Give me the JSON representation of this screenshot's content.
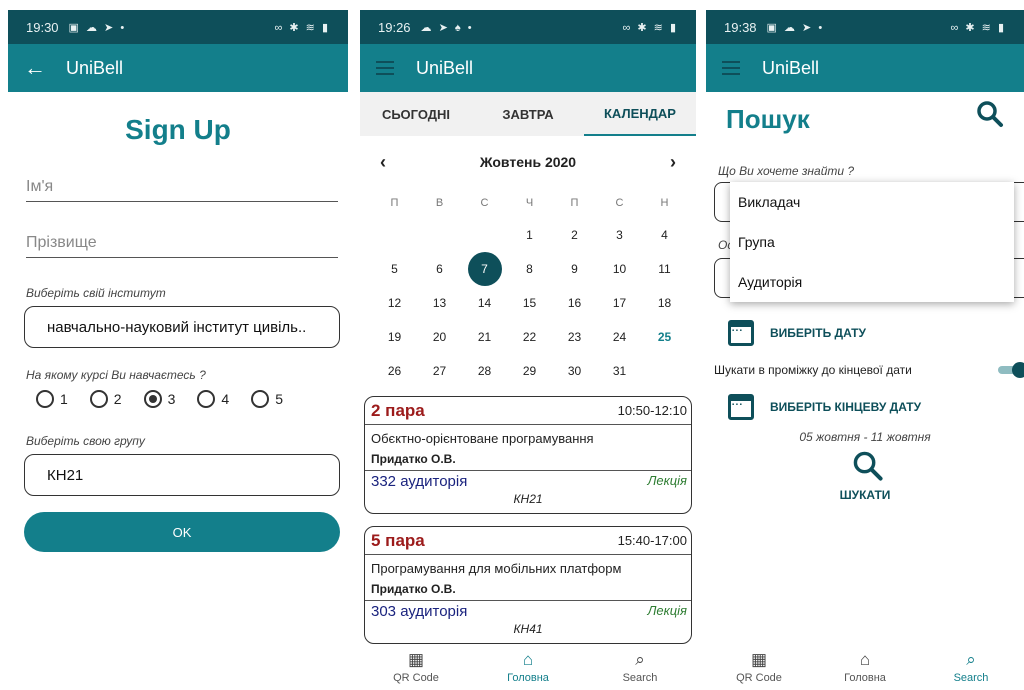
{
  "colors": {
    "primary": "#137f8b",
    "dark": "#0e4f5a",
    "pair_number": "#9c1b1b",
    "room": "#1a237e",
    "type": "#2e7d32"
  },
  "signup": {
    "status_time": "19:30",
    "app_title": "UniBell",
    "title": "Sign Up",
    "first_name_placeholder": "Ім'я",
    "last_name_placeholder": "Прізвище",
    "institute_label": "Виберіть свій інститут",
    "institute_value": "навчально-науковий інститут цивіль..",
    "course_label": "На якому курсі Ви навчаєтесь ?",
    "courses": [
      "1",
      "2",
      "3",
      "4",
      "5"
    ],
    "selected_course": "3",
    "group_label": "Виберіть свою групу",
    "group_value": "КН21",
    "ok_label": "OK"
  },
  "calendar_screen": {
    "status_time": "19:26",
    "app_title": "UniBell",
    "tabs": [
      "СЬОГОДНІ",
      "ЗАВТРА",
      "КАЛЕНДАР"
    ],
    "active_tab": "КАЛЕНДАР",
    "month": "Жовтень 2020",
    "weekdays": [
      "П",
      "В",
      "С",
      "Ч",
      "П",
      "С",
      "Н"
    ],
    "days": [
      "",
      "",
      "",
      "1",
      "2",
      "3",
      "4",
      "5",
      "6",
      "7",
      "8",
      "9",
      "10",
      "11",
      "12",
      "13",
      "14",
      "15",
      "16",
      "17",
      "18",
      "19",
      "20",
      "21",
      "22",
      "23",
      "24",
      "25",
      "26",
      "27",
      "28",
      "29",
      "30",
      "31",
      ""
    ],
    "selected_day": "7",
    "highlighted_day": "25",
    "lessons": [
      {
        "number": "2 пара",
        "time": "10:50-12:10",
        "subject": "Обєктно-орієнтоване програмування",
        "teacher": "Придатко О.В.",
        "room": "332 аудиторія",
        "type": "Лекція",
        "group": "КН21"
      },
      {
        "number": "5 пара",
        "time": "15:40-17:00",
        "subject": "Програмування для мобільних платформ",
        "teacher": "Придатко О.В.",
        "room": "303 аудиторія",
        "type": "Лекція",
        "group": "КН41"
      }
    ],
    "nav": {
      "qr": "QR Code",
      "home": "Головна",
      "search": "Search"
    }
  },
  "search_screen": {
    "status_time": "19:38",
    "app_title": "UniBell",
    "title": "Пошук",
    "what_label": "Що Ви хочете знайти ?",
    "second_label_partial": "Ос",
    "dropdown_options": [
      "Викладач",
      "Група",
      "Аудиторія"
    ],
    "choose_date": "ВИБЕРІТЬ ДАТУ",
    "range_toggle_label": "Шукати в проміжку до кінцевої дати",
    "range_toggle_on": true,
    "choose_end_date": "ВИБЕРІТЬ КІНЦЕВУ ДАТУ",
    "date_range": "05 жовтня - 11 жовтня",
    "search_button": "ШУКАТИ",
    "nav": {
      "qr": "QR Code",
      "home": "Головна",
      "search": "Search"
    }
  }
}
